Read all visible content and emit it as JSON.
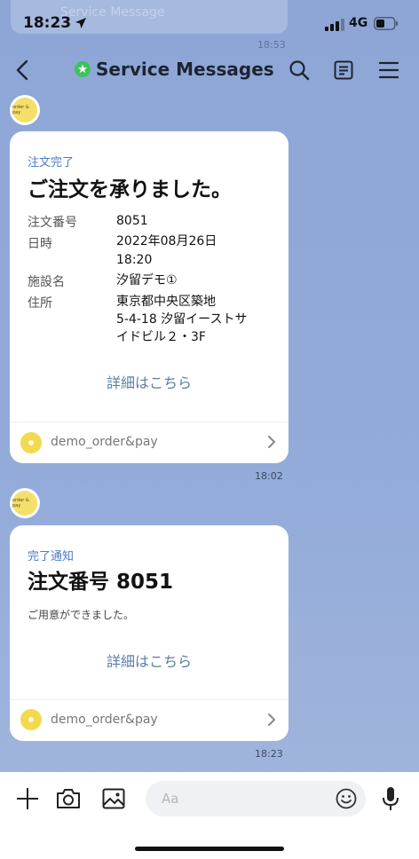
{
  "status_bar": {
    "time": "18:23",
    "network": "4G"
  },
  "ghost_notification": {
    "title": "Service Message",
    "time": "18:53"
  },
  "header": {
    "title": "Service Messages"
  },
  "messages": [
    {
      "label": "注文完了",
      "heading": "ご注文を承りました。",
      "rows": [
        {
          "key": "注文番号",
          "value": "8051"
        },
        {
          "key": "日時",
          "value": "2022年08月26日",
          "value2": "18:20"
        },
        {
          "key": "施設名",
          "value": "汐留デモ①"
        },
        {
          "key": "住所",
          "value": "東京都中央区築地",
          "value2": "5-4-18 汐留イーストサ",
          "value3": "イドビル２・3F"
        }
      ],
      "link": "詳細はこちら",
      "footer": "demo_order&pay",
      "time": "18:02"
    },
    {
      "label": "完了通知",
      "heading": "注文番号 8051",
      "body": "ご用意ができました。",
      "link": "詳細はこちら",
      "footer": "demo_order&pay",
      "time": "18:23"
    }
  ],
  "input": {
    "placeholder": "Aa"
  },
  "avatar": {
    "brand_text": "order & pay"
  },
  "colors": {
    "background": "#8ea6d6",
    "accent": "#4b7cc6",
    "link": "#5a7fa5",
    "verified": "#3bc45a"
  }
}
